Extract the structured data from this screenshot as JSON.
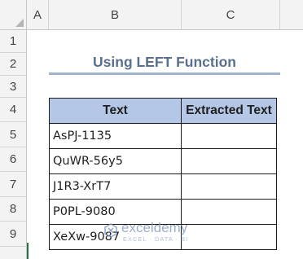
{
  "sheet": {
    "columns": [
      "A",
      "B",
      "C"
    ],
    "rows": [
      "1",
      "2",
      "3",
      "4",
      "5",
      "6",
      "7",
      "8",
      "9"
    ]
  },
  "title": "Using LEFT Function",
  "table": {
    "headers": [
      "Text",
      "Extracted Text"
    ],
    "rows": [
      {
        "text": "AsPJ-1135",
        "extracted": ""
      },
      {
        "text": "QuWR-56y5",
        "extracted": ""
      },
      {
        "text": "J1R3-XrT7",
        "extracted": ""
      },
      {
        "text": "P0PL-9080",
        "extracted": ""
      },
      {
        "text": "XeXw-9087",
        "extracted": ""
      }
    ]
  },
  "watermark": {
    "name": "exceldemy",
    "tagline": "EXCEL · DATA · BI"
  },
  "colors": {
    "header_fill": "#b4c7e7",
    "title_color": "#5a6f8b",
    "title_underline": "#9fb4cf"
  }
}
